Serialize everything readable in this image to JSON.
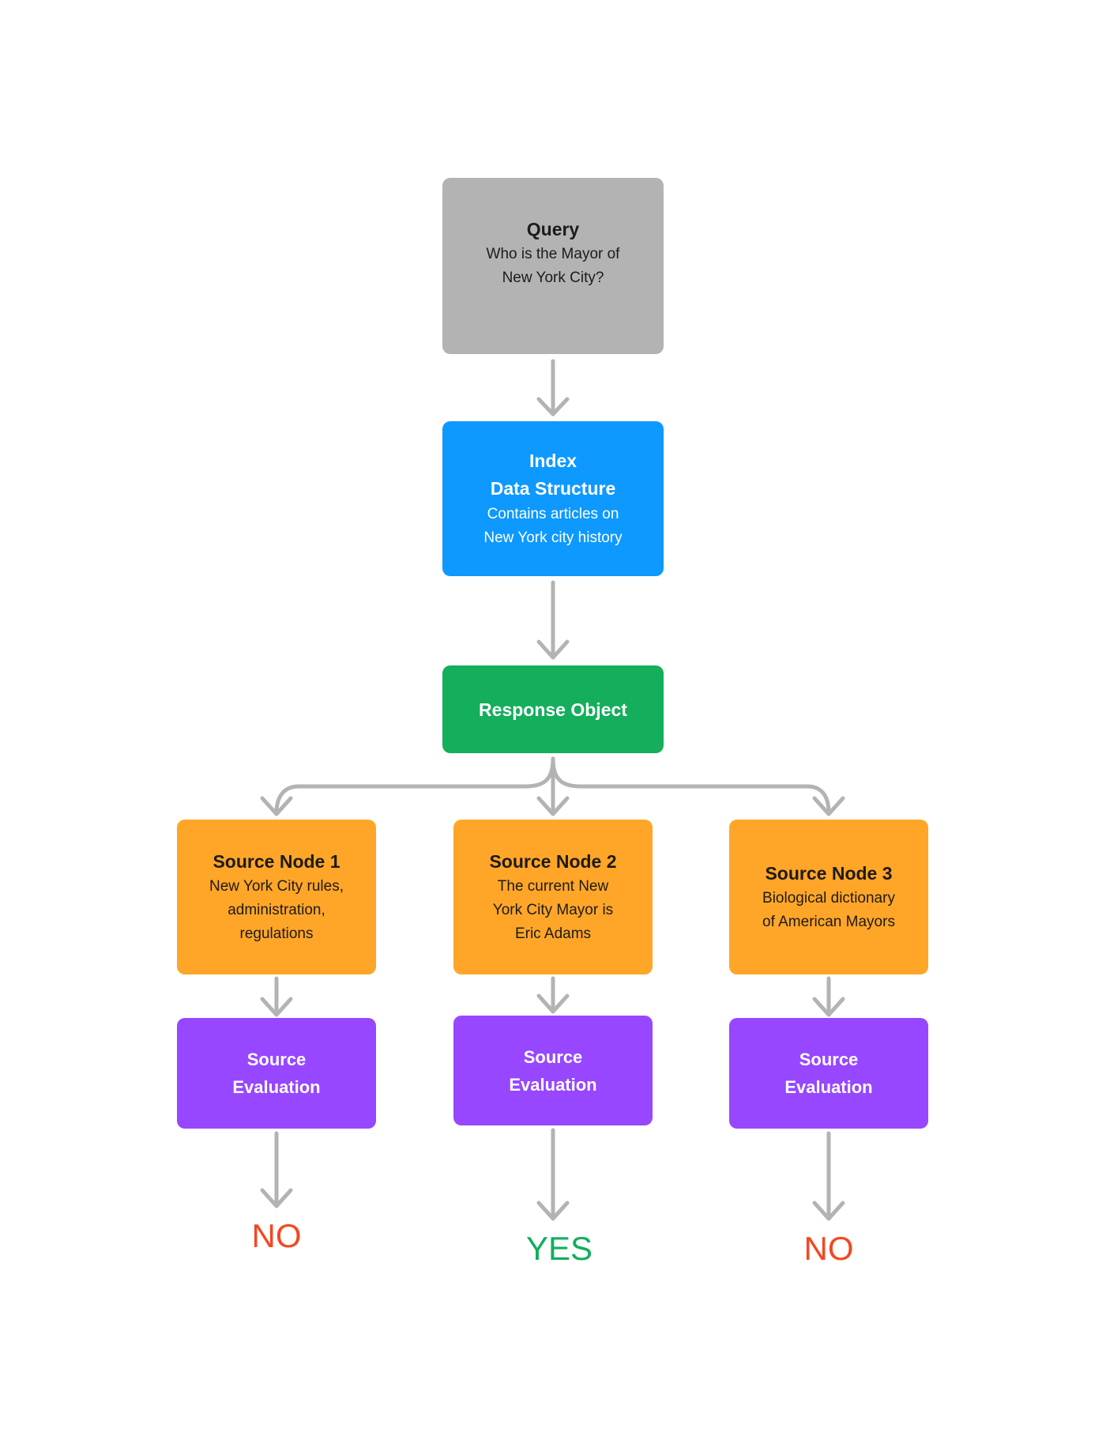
{
  "colors": {
    "query": "#b3b3b3",
    "index": "#0d99ff",
    "response": "#14ae5c",
    "source": "#ffa629",
    "evaluation": "#9747ff",
    "connector": "#b3b3b3",
    "no": "#f24822",
    "yes": "#14ae5c"
  },
  "query": {
    "title": "Query",
    "lines": [
      "Who is the Mayor of",
      "New York City?"
    ]
  },
  "index": {
    "title_lines": [
      "Index",
      "Data Structure"
    ],
    "lines": [
      "Contains articles on",
      "New York city history"
    ]
  },
  "response": {
    "title": "Response Object"
  },
  "sources": [
    {
      "title": "Source Node 1",
      "lines": [
        "New York City rules,",
        "administration,",
        "regulations"
      ]
    },
    {
      "title": "Source Node 2",
      "lines": [
        "The current New",
        "York City Mayor is",
        "Eric Adams"
      ]
    },
    {
      "title": "Source Node 3",
      "lines": [
        "Biological dictionary",
        "of American Mayors"
      ]
    }
  ],
  "evaluations": [
    {
      "title_lines": [
        "Source",
        "Evaluation"
      ]
    },
    {
      "title_lines": [
        "Source",
        "Evaluation"
      ]
    },
    {
      "title_lines": [
        "Source",
        "Evaluation"
      ]
    }
  ],
  "results": [
    "NO",
    "YES",
    "NO"
  ]
}
